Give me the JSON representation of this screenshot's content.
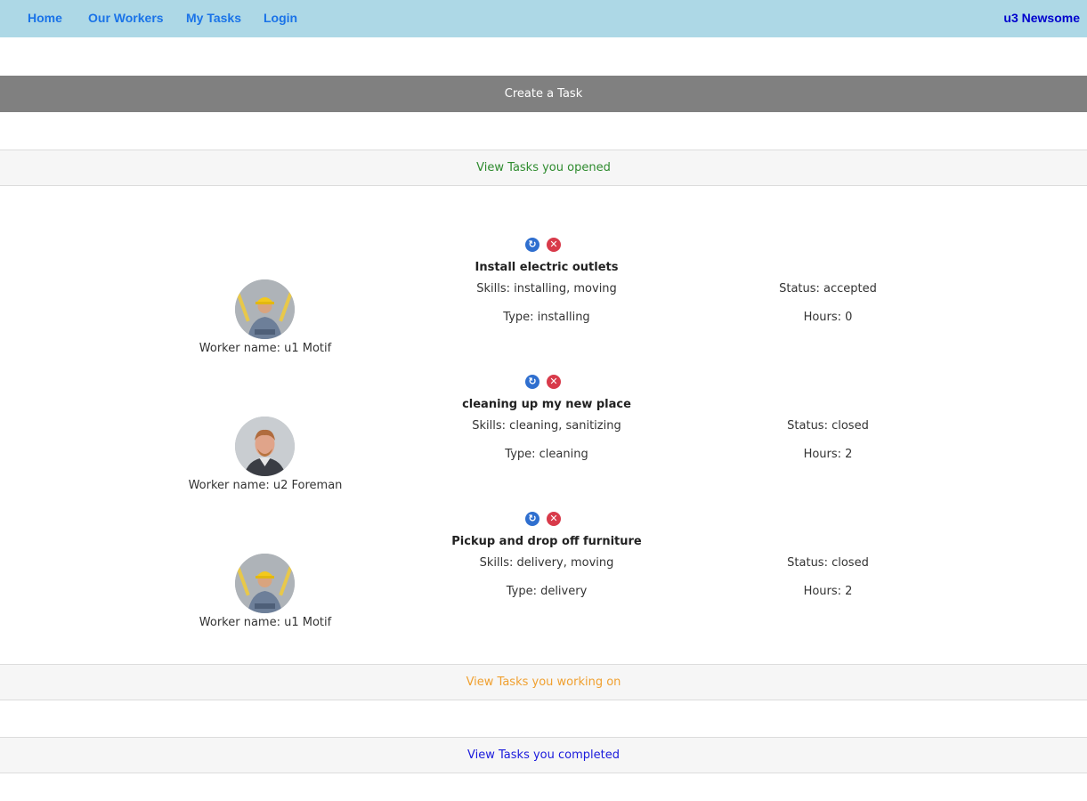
{
  "nav": {
    "home": "Home",
    "workers": "Our Workers",
    "my_tasks": "My Tasks",
    "login": "Login",
    "user": "u3 Newsome"
  },
  "create_task": "Create a Task",
  "sections": {
    "opened": {
      "label": "View Tasks you opened",
      "color": "#2e8b2e"
    },
    "working": {
      "label": "View Tasks you working on",
      "color": "#f0a030"
    },
    "completed": {
      "label": "View Tasks you completed",
      "color": "#1a1adc"
    }
  },
  "tasks": [
    {
      "title": "Install electric outlets",
      "skills": "Skills: installing, moving",
      "type": "Type: installing",
      "status": "Status: accepted",
      "hours": "Hours: 0",
      "worker": "Worker name: u1 Motif",
      "avatar": "worker-hardhat"
    },
    {
      "title": "cleaning up my new place",
      "skills": "Skills: cleaning, sanitizing",
      "type": "Type: cleaning",
      "status": "Status: closed",
      "hours": "Hours: 2",
      "worker": "Worker name: u2 Foreman",
      "avatar": "worker-portrait"
    },
    {
      "title": "Pickup and drop off furniture",
      "skills": "Skills: delivery, moving",
      "type": "Type: delivery",
      "status": "Status: closed",
      "hours": "Hours: 2",
      "worker": "Worker name: u1 Motif",
      "avatar": "worker-hardhat"
    }
  ]
}
